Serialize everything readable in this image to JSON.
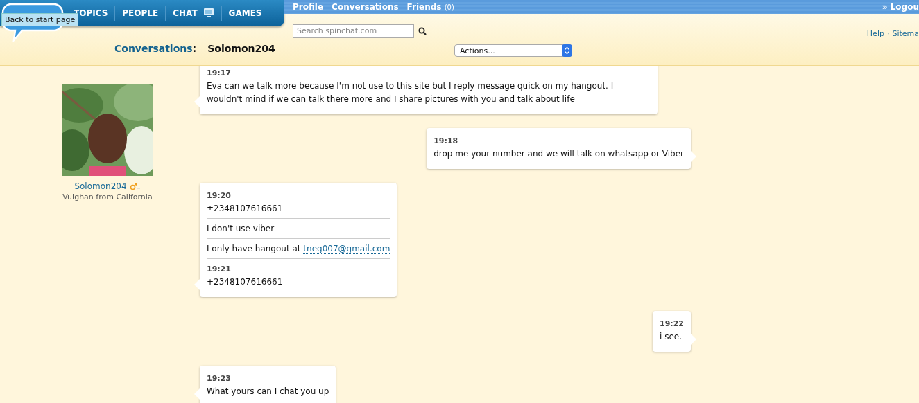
{
  "logo": {
    "tooltip": "Back to start page"
  },
  "nav": [
    {
      "label": "TOPICS",
      "icon": false
    },
    {
      "label": "PEOPLE",
      "icon": false
    },
    {
      "label": "CHAT",
      "icon": true
    },
    {
      "label": "GAMES",
      "icon": false
    }
  ],
  "top_links": [
    {
      "label": "Profile"
    },
    {
      "label": "Conversations"
    },
    {
      "label": "Friends",
      "count": "(0)"
    }
  ],
  "logout": "» Logou",
  "search": {
    "placeholder": "Search spinchat.com"
  },
  "help_links": [
    "Help",
    "Sitema"
  ],
  "help_separator": "·",
  "breadcrumb": {
    "section": "Conversations",
    "separator": ":",
    "name": "Solomon204"
  },
  "actions": {
    "value": "Actions..."
  },
  "profile": {
    "name": "Solomon204",
    "location": "Vulghan from California"
  },
  "messages": [
    {
      "kind": "incoming",
      "entries": [
        {
          "time": "19:17",
          "text": "Eva can we talk more because I'm not use to this site but I reply message quick on my hangout. I wouldn't mind if we can talk there more and I share pictures with you and talk about life"
        }
      ]
    },
    {
      "kind": "outgoing",
      "entries": [
        {
          "time": "19:18",
          "text": "drop me your number and we will talk on whatsapp or Viber"
        }
      ]
    },
    {
      "kind": "incoming",
      "entries": [
        {
          "time": "19:20",
          "text": "±2348107616661"
        },
        {
          "text": "I don't use viber"
        },
        {
          "text": "I only have hangout at ",
          "link": "tneg007@gmail.com"
        },
        {
          "time": "19:21",
          "text": "+2348107616661"
        }
      ]
    },
    {
      "kind": "outgoing",
      "entries": [
        {
          "time": "19:22",
          "text": "i see."
        }
      ]
    },
    {
      "kind": "incoming",
      "entries": [
        {
          "time": "19:23",
          "text": "What yours can I chat you up"
        }
      ]
    }
  ]
}
